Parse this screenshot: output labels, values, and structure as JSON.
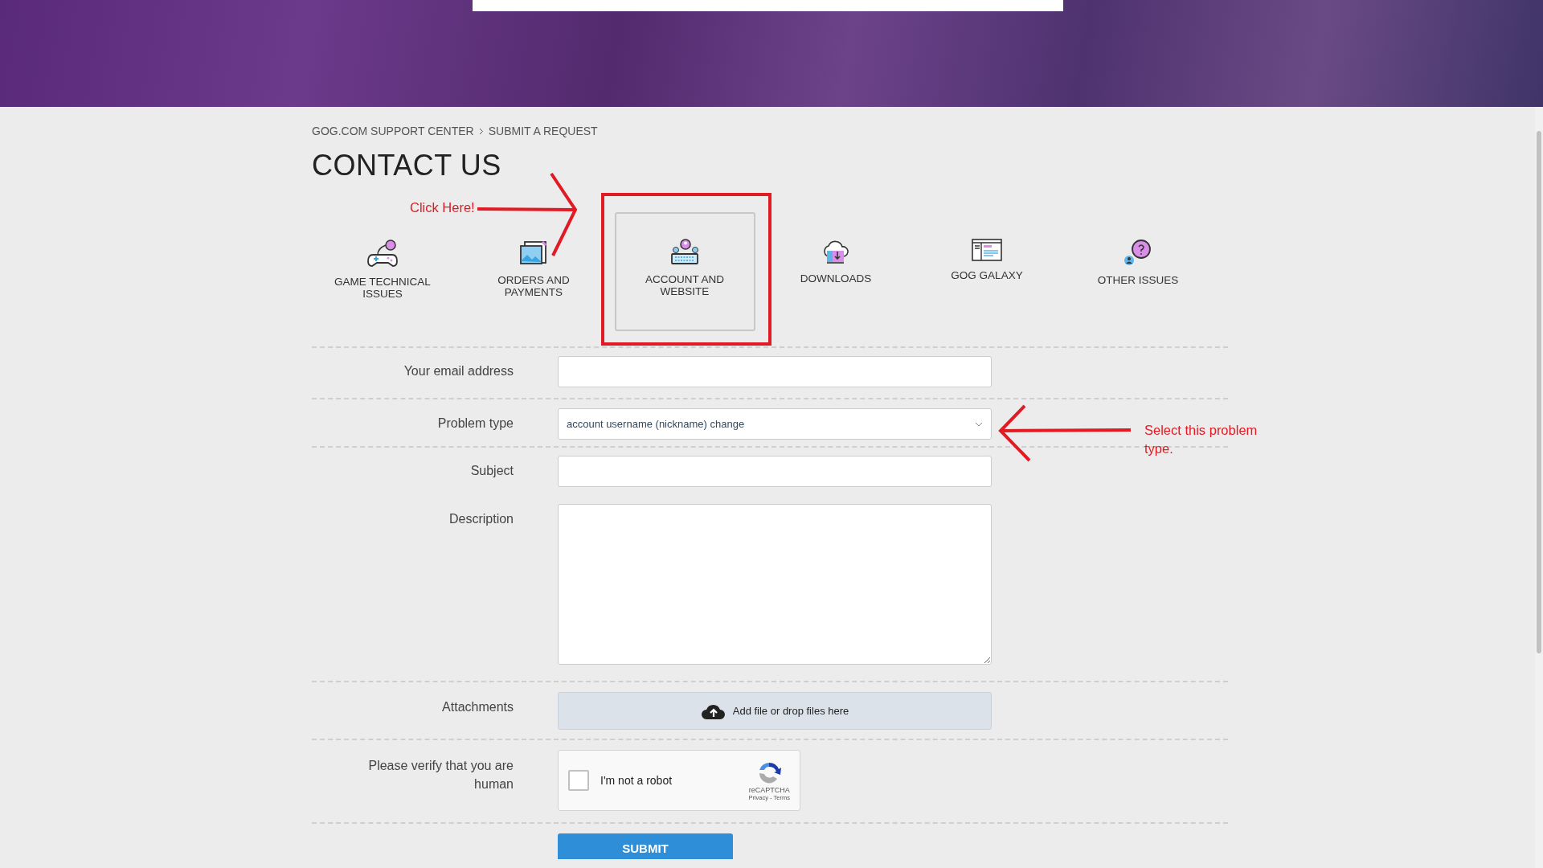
{
  "breadcrumb": [
    "GOG.COM SUPPORT CENTER",
    "SUBMIT A REQUEST"
  ],
  "title": "CONTACT US",
  "categories": [
    {
      "kind": "gamepad",
      "label": "GAME TECHNICAL ISSUES",
      "selected": false
    },
    {
      "kind": "photos",
      "label": "ORDERS AND PAYMENTS",
      "selected": false
    },
    {
      "kind": "keyboard",
      "label": "ACCOUNT AND WEBSITE",
      "selected": true
    },
    {
      "kind": "cloud",
      "label": "DOWNLOADS",
      "selected": false
    },
    {
      "kind": "window",
      "label": "GOG GALAXY",
      "selected": false
    },
    {
      "kind": "question",
      "label": "OTHER ISSUES",
      "selected": false
    }
  ],
  "form": [
    {
      "kind": "text",
      "label": "Your email address",
      "divider": true
    },
    {
      "kind": "select",
      "label": "Problem type",
      "value": "account username (nickname) change",
      "divider": true
    },
    {
      "kind": "text",
      "label": "Subject",
      "divider": false
    },
    {
      "kind": "textarea",
      "label": "Description",
      "divider": true
    },
    {
      "kind": "file",
      "label": "Attachments",
      "value": "Add file or drop files here",
      "divider": true
    },
    {
      "kind": "captcha",
      "label": "Please verify that you are human",
      "value": "I'm not a robot",
      "checked": false,
      "brand": "reCAPTCHA",
      "links": "Privacy - Terms",
      "divider": true
    }
  ],
  "submit": "SUBMIT",
  "annotations": {
    "click_note": "Click Here!",
    "select_note": "Select this problem type."
  }
}
